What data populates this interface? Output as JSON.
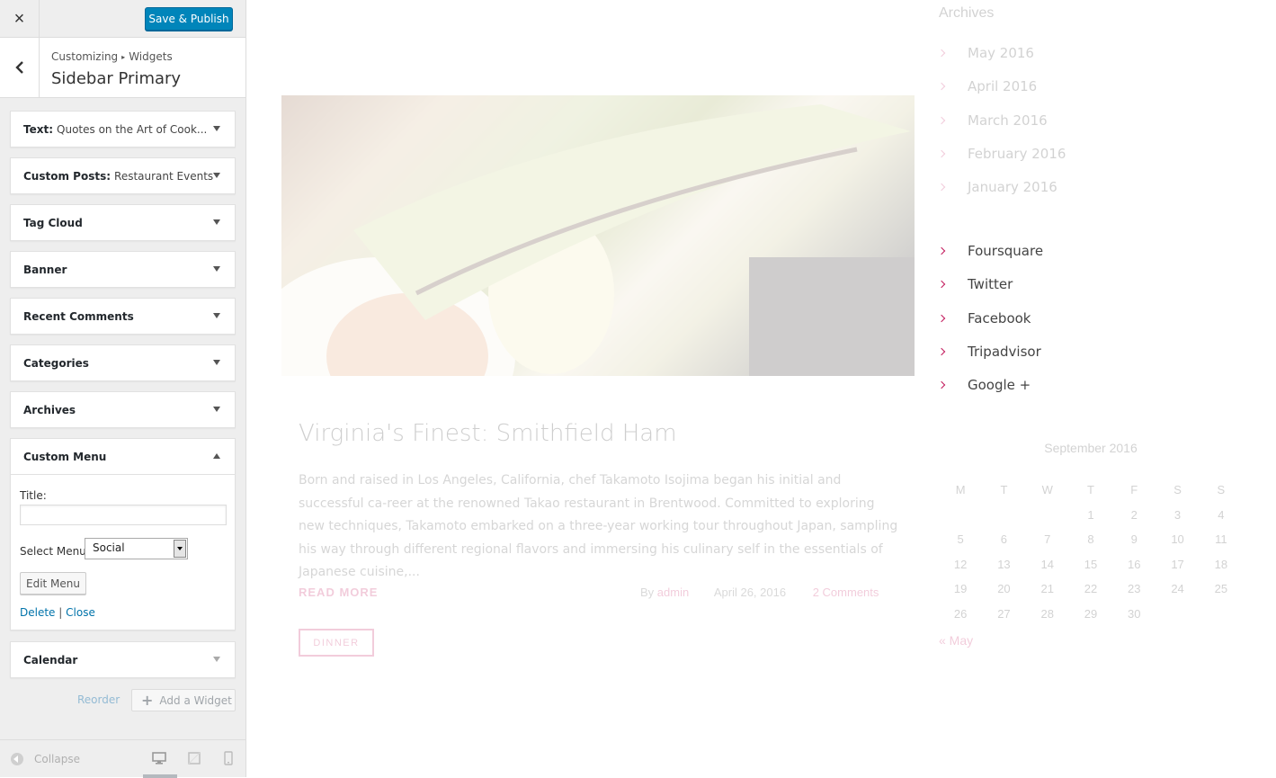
{
  "customizer": {
    "close_label": "×",
    "publish_label": "Save & Publish",
    "breadcrumb": {
      "root": "Customizing",
      "sep": "▸",
      "section": "Widgets"
    },
    "panel_title": "Sidebar Primary",
    "widgets": [
      {
        "type": "Text:",
        "title": "Quotes on the Art of Cook..."
      },
      {
        "type": "Custom Posts:",
        "title": "Restaurant Events"
      },
      {
        "type": "Tag Cloud",
        "title": ""
      },
      {
        "type": "Banner",
        "title": ""
      },
      {
        "type": "Recent Comments",
        "title": ""
      },
      {
        "type": "Categories",
        "title": ""
      },
      {
        "type": "Archives",
        "title": ""
      },
      {
        "type": "Custom Menu",
        "title": ""
      },
      {
        "type": "Calendar",
        "title": ""
      }
    ],
    "custom_menu_form": {
      "title_label": "Title:",
      "title_value": "",
      "select_label": "Select Menu:",
      "select_value": "Social",
      "edit_button": "Edit Menu",
      "delete_link": "Delete",
      "divider": "|",
      "close_link": "Close"
    },
    "reorder_label": "Reorder",
    "add_widget_plus": "+",
    "add_widget_label": "Add a Widget",
    "collapse_label": "Collapse"
  },
  "preview": {
    "post": {
      "title": "Virginia's Finest: Smithfield Ham",
      "excerpt": "Born and raised in Los Angeles, California, chef Takamoto Isojima began his initial and successful ca-reer at the renowned Takao restaurant in Brentwood. Committed to exploring new techniques, Takamoto embarked on a three-year working tour throughout Japan, sampling his way through different regional flavors and immersing his culinary self in the essentials of Japanese cuisine,...",
      "read_more": "READ MORE",
      "by_label": "By",
      "author": "admin",
      "date": "April 26, 2016",
      "comments": "2 Comments",
      "tag": "DINNER"
    },
    "archives": {
      "title": "Archives",
      "items": [
        "May 2016",
        "April 2016",
        "March 2016",
        "February 2016",
        "January 2016"
      ]
    },
    "social_menu": [
      "Foursquare",
      "Twitter",
      "Facebook",
      "Tripadvisor",
      "Google +"
    ],
    "calendar": {
      "caption": "September 2016",
      "weekdays": [
        "M",
        "T",
        "W",
        "T",
        "F",
        "S",
        "S"
      ],
      "weeks": [
        [
          "",
          "",
          "",
          "1",
          "2",
          "3",
          "4"
        ],
        [
          "5",
          "6",
          "7",
          "8",
          "9",
          "10",
          "11"
        ],
        [
          "12",
          "13",
          "14",
          "15",
          "16",
          "17",
          "18"
        ],
        [
          "19",
          "20",
          "21",
          "22",
          "23",
          "24",
          "25"
        ],
        [
          "26",
          "27",
          "28",
          "29",
          "30",
          "",
          ""
        ]
      ],
      "prev_link": "« May"
    },
    "accent_color": "#c2185b"
  }
}
